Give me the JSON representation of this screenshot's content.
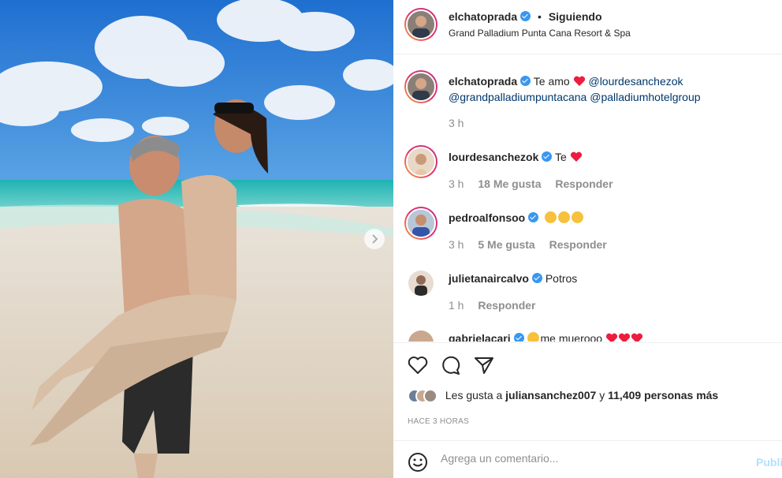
{
  "post": {
    "author": "elchatoprada",
    "separator": "•",
    "follow_status": "Siguiendo",
    "location": "Grand Palladium Punta Cana Resort & Spa"
  },
  "caption": {
    "username": "elchatoprada",
    "text": "Te amo",
    "mention1": "@lourdesanchezok",
    "mention2": "@grandpalladiumpuntacana",
    "mention3": "@palladiumhotelgroup",
    "time": "3 h"
  },
  "comments": [
    {
      "username": "lourdesanchezok",
      "text": "Te",
      "time": "3 h",
      "likes": "18 Me gusta",
      "reply": "Responder"
    },
    {
      "username": "pedroalfonsoo",
      "text": "",
      "time": "3 h",
      "likes": "5 Me gusta",
      "reply": "Responder"
    },
    {
      "username": "julietanaircalvo",
      "text": "Potros",
      "time": "1 h",
      "reply": "Responder"
    },
    {
      "username": "gabrielacari",
      "text": "me muerooo"
    }
  ],
  "likes": {
    "prefix": "Les gusta a",
    "user": "juliansanchez007",
    "middle": "y",
    "count": "11,409 personas más"
  },
  "time_ago": "HACE 3 HORAS",
  "add_comment": {
    "placeholder": "Agrega un comentario...",
    "publish": "Publicar"
  },
  "icons": [
    "chevron-right-icon",
    "heart-icon",
    "comment-icon",
    "share-icon",
    "emoji-icon",
    "verified-icon"
  ],
  "colors": {
    "link": "#00376b",
    "verified": "#3897f0",
    "meta": "#8e8e8e",
    "publish": "#b2dffc",
    "heart": "#ed1d3f"
  }
}
